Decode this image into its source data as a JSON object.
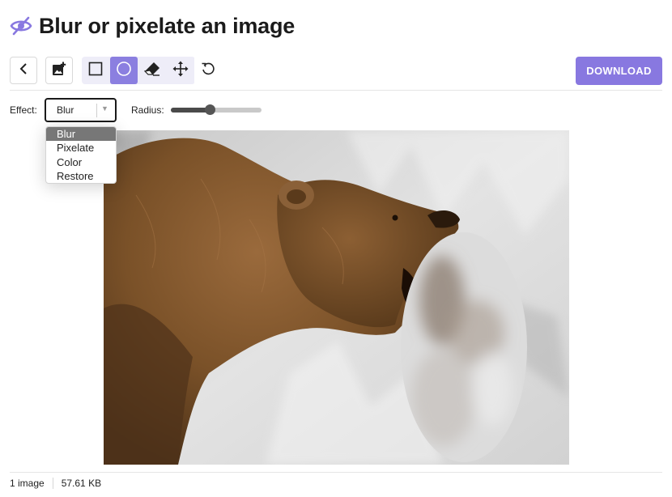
{
  "header": {
    "title": "Blur or pixelate an image",
    "icon": "eye-slash-icon",
    "accent_color": "#8878e0"
  },
  "toolbar": {
    "back_icon": "chevron-left-icon",
    "add_image_icon": "add-image-icon",
    "tools": [
      {
        "name": "rectangle",
        "icon": "square-icon",
        "active": false
      },
      {
        "name": "ellipse",
        "icon": "circle-icon",
        "active": true
      },
      {
        "name": "eraser",
        "icon": "eraser-icon",
        "active": false
      },
      {
        "name": "move",
        "icon": "move-arrows-icon",
        "active": false
      }
    ],
    "reset_icon": "rotate-icon",
    "download_label": "DOWNLOAD"
  },
  "options": {
    "effect_label": "Effect:",
    "effect_value": "Blur",
    "effect_options": [
      "Blur",
      "Pixelate",
      "Color",
      "Restore"
    ],
    "radius_label": "Radius:",
    "radius_fraction": 0.43
  },
  "image": {
    "subject": "brown bear catching fish in waterfall",
    "blur_region": "ellipse"
  },
  "status": {
    "count": "1 image",
    "size": "57.61 KB"
  }
}
